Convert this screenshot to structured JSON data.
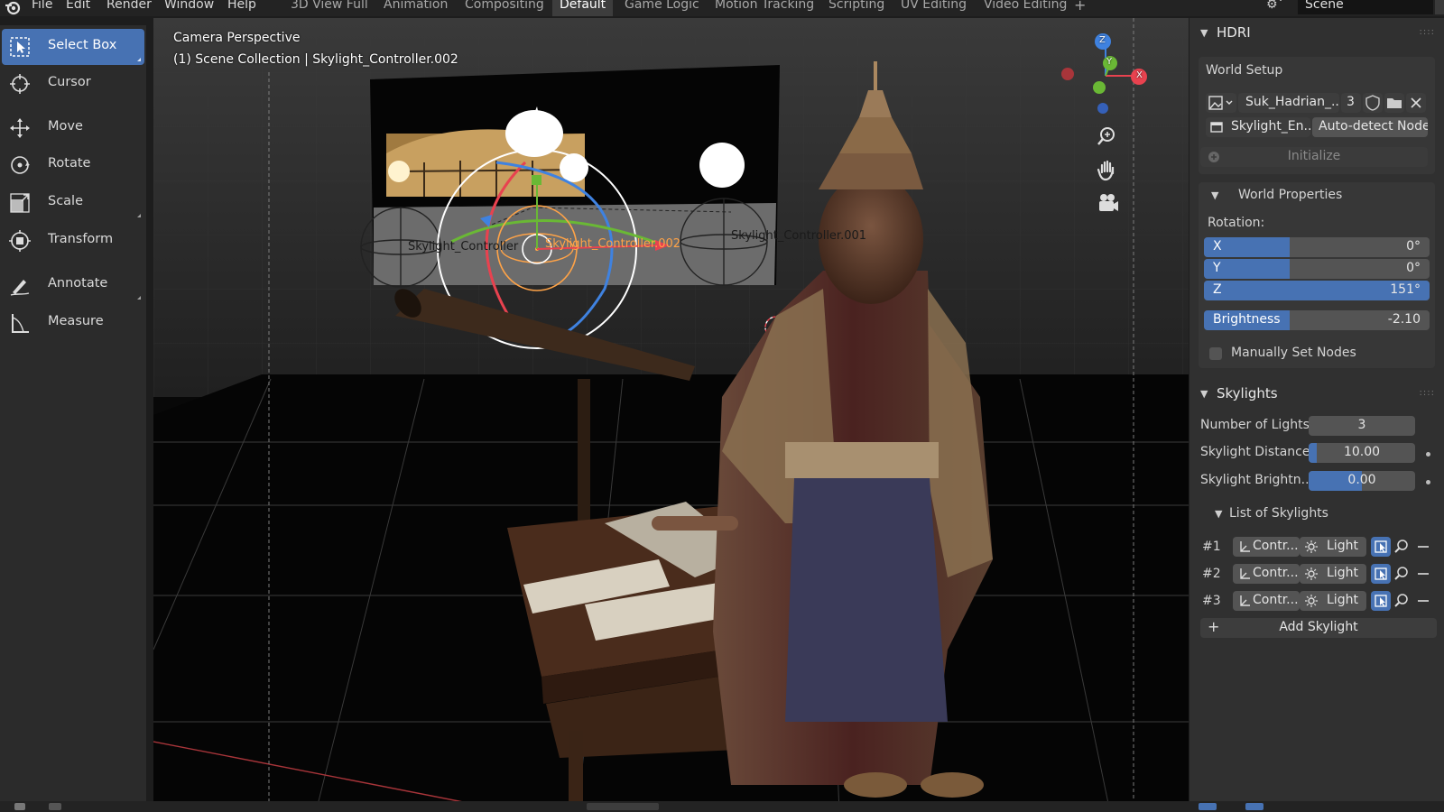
{
  "topbar": {
    "menus": [
      "File",
      "Edit",
      "Render",
      "Window",
      "Help"
    ],
    "workspaces": [
      "3D View Full",
      "Animation",
      "Compositing",
      "Default",
      "Game Logic",
      "Motion Tracking",
      "Scripting",
      "UV Editing",
      "Video Editing"
    ],
    "active_workspace": "Default",
    "add_workspace": "+",
    "scene_name": "Scene"
  },
  "toolbar": {
    "tools": [
      {
        "label": "Select Box",
        "icon": "select-box-icon",
        "active": true
      },
      {
        "label": "Cursor",
        "icon": "cursor-icon",
        "active": false
      },
      {
        "label": "Move",
        "icon": "move-icon",
        "active": false
      },
      {
        "label": "Rotate",
        "icon": "rotate-icon",
        "active": false
      },
      {
        "label": "Scale",
        "icon": "scale-icon",
        "active": false
      },
      {
        "label": "Transform",
        "icon": "transform-icon",
        "active": false
      },
      {
        "label": "Annotate",
        "icon": "annotate-icon",
        "active": false
      },
      {
        "label": "Measure",
        "icon": "measure-icon",
        "active": false
      }
    ]
  },
  "viewport": {
    "perspective": "Camera Perspective",
    "collection": "(1) Scene Collection | Skylight_Controller.002",
    "labels": {
      "controller": "Skylight_Controller",
      "controller_002": "Skylight_Controller.002",
      "controller_001": "Skylight_Controller.001"
    },
    "gizmo_axes": {
      "x": "X",
      "y": "Y",
      "z": "Z"
    },
    "accent_colors": {
      "x": "#e8424f",
      "y": "#6ab835",
      "z": "#3f82e0",
      "selected": "#ffa347"
    }
  },
  "hdri": {
    "title": "HDRI",
    "world_setup": "World Setup",
    "image_name": "Suk_Hadrian_...",
    "users": "3",
    "node_name": "Skylight_En...",
    "auto_detect": "Auto-detect Node",
    "initialize": "Initialize",
    "world_properties": "World Properties",
    "rotation_label": "Rotation:",
    "rotation": [
      {
        "axis": "X",
        "value": "0°",
        "fill": 0.38
      },
      {
        "axis": "Y",
        "value": "0°",
        "fill": 0.38
      },
      {
        "axis": "Z",
        "value": "151°",
        "fill": 1.0
      }
    ],
    "brightness": {
      "label": "Brightness",
      "value": "-2.10",
      "fill": 0.38
    },
    "manual_nodes": "Manually Set Nodes"
  },
  "skylights": {
    "title": "Skylights",
    "fields": [
      {
        "label": "Number of Lights",
        "value": "3",
        "fill": 0.0
      },
      {
        "label": "Skylight Distance",
        "value": "10.00",
        "fill": 0.08
      },
      {
        "label": "Skylight Brightn...",
        "value": "0.00",
        "fill": 0.5
      }
    ],
    "list_title": "List of Skylights",
    "rows": [
      {
        "index": "#1",
        "controller": "Contr...",
        "light": "Light"
      },
      {
        "index": "#2",
        "controller": "Contr...",
        "light": "Light"
      },
      {
        "index": "#3",
        "controller": "Contr...",
        "light": "Light"
      }
    ],
    "add_button": "Add Skylight"
  }
}
